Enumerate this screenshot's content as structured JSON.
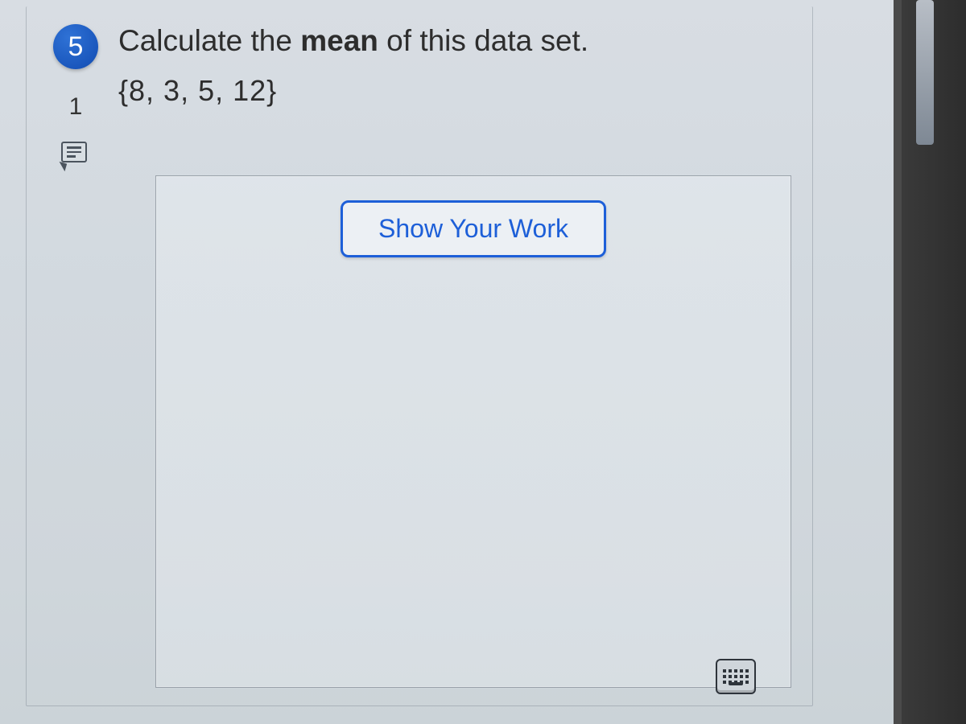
{
  "question": {
    "number": "5",
    "sub_number": "1",
    "prompt_pre": "Calculate the ",
    "prompt_bold": "mean",
    "prompt_post": " of this data set.",
    "dataset": "{8, 3, 5, 12}"
  },
  "work_panel": {
    "button_label": "Show Your Work"
  },
  "icons": {
    "comment": "comment-bubble-icon",
    "keyboard": "keyboard-icon"
  }
}
